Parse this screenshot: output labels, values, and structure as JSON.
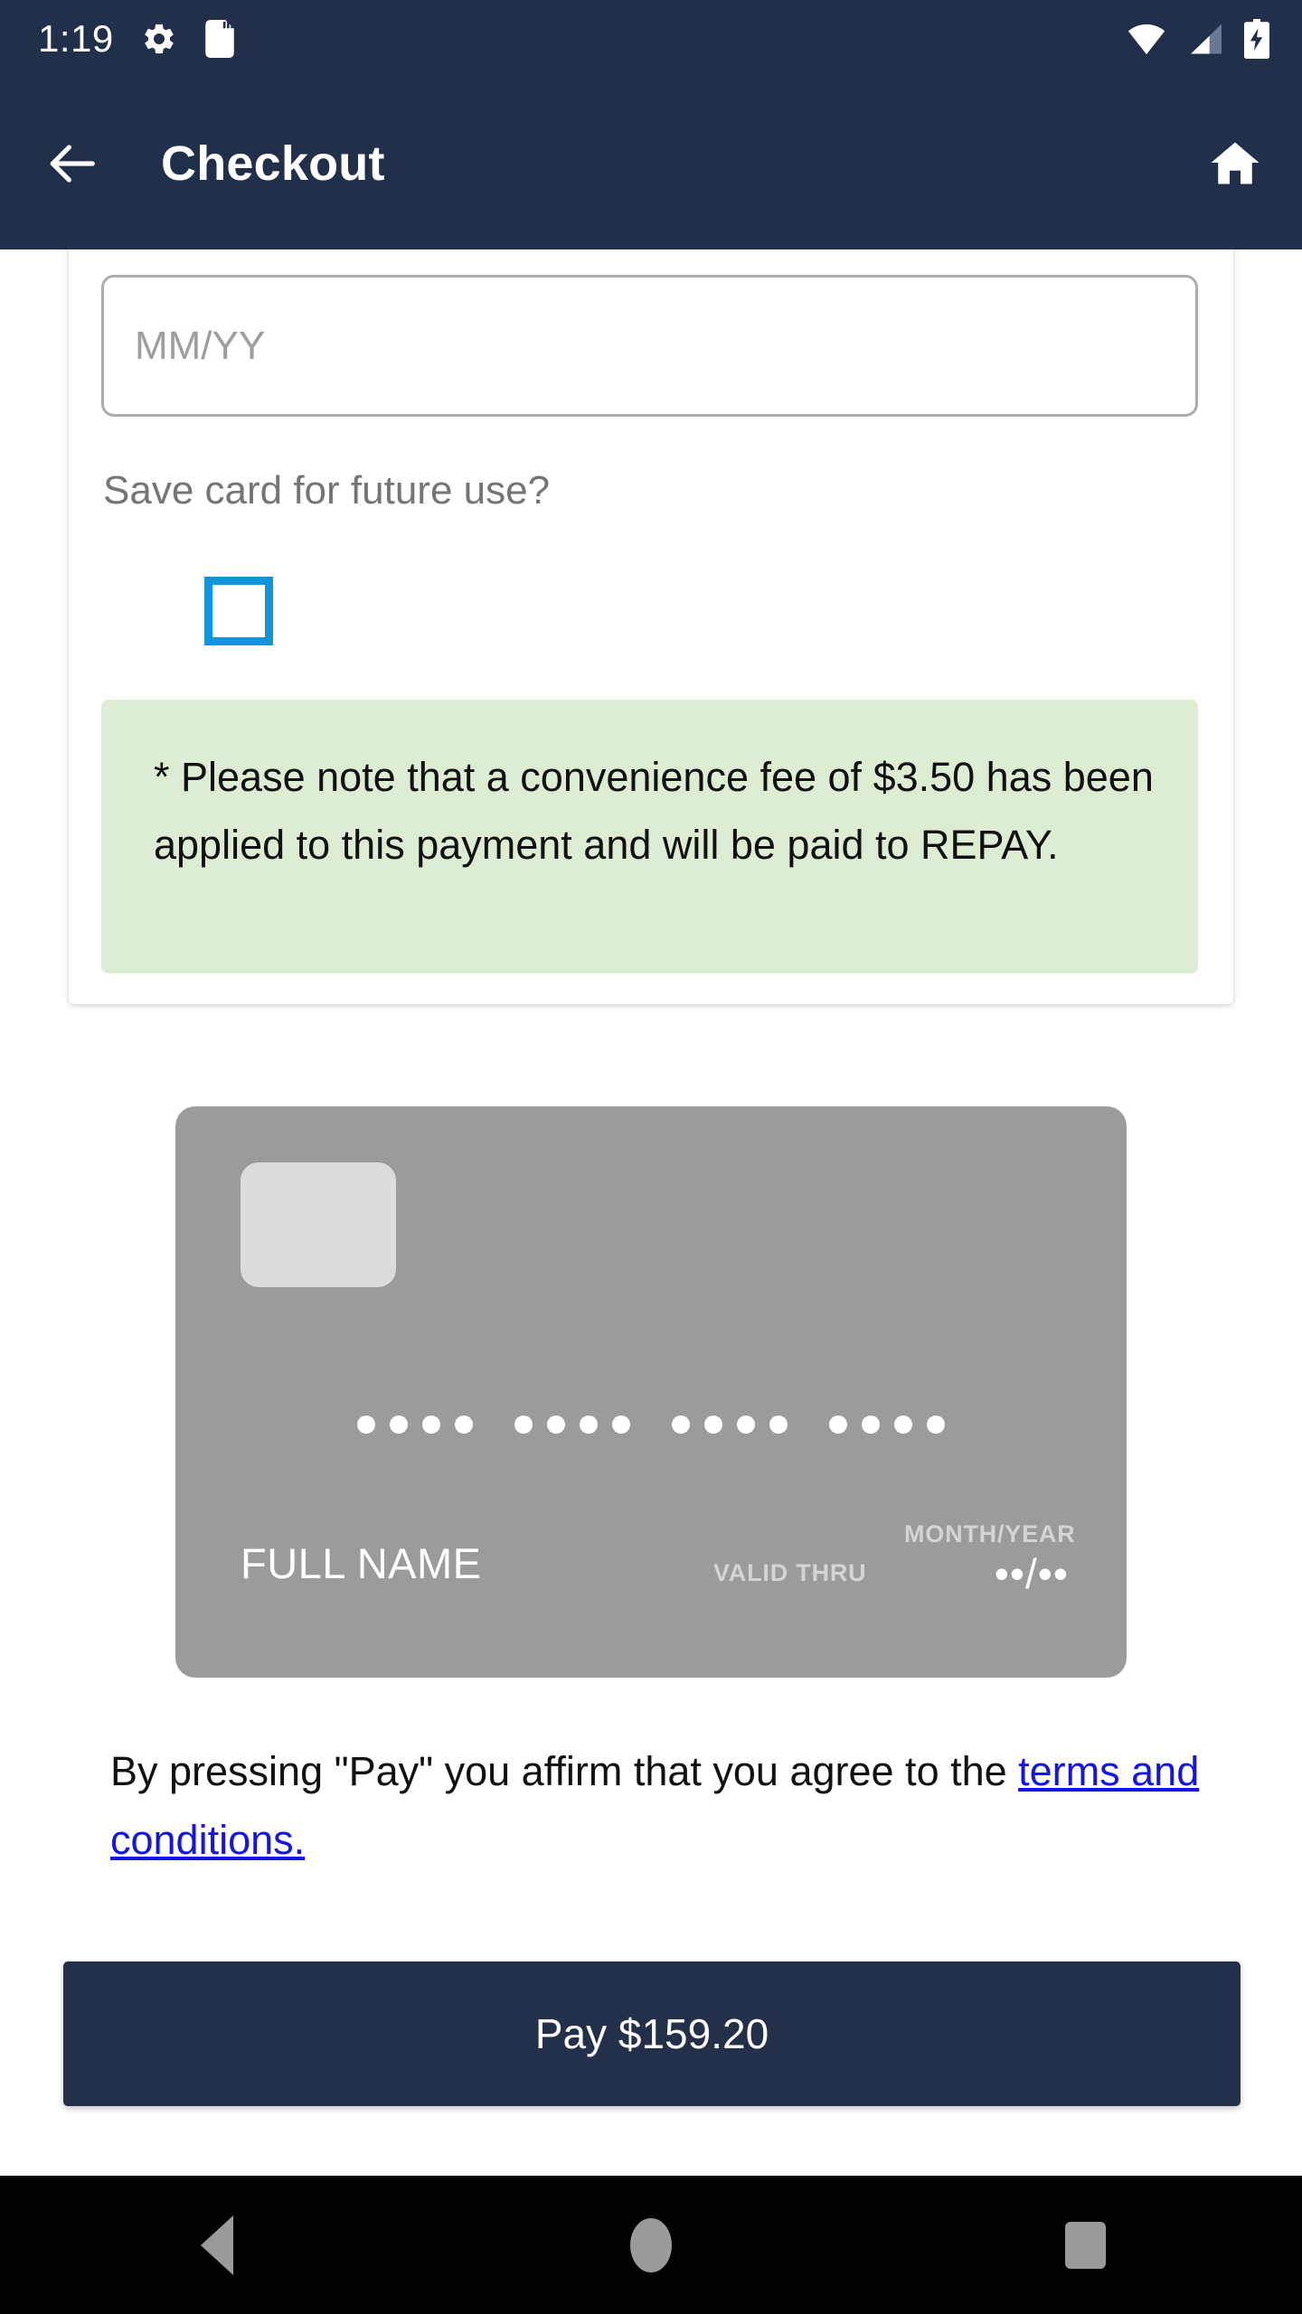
{
  "status_bar": {
    "time": "1:19",
    "left_icons": [
      "settings-gear-icon",
      "sd-card-icon"
    ],
    "right_icons": [
      "wifi-icon",
      "cellular-signal-icon",
      "battery-charging-icon"
    ],
    "background_color": "#222F4B"
  },
  "app_bar": {
    "back_icon": "back-arrow-icon",
    "title": "Checkout",
    "home_icon": "home-icon",
    "background_color": "#222F4B"
  },
  "form": {
    "clipped_label": "",
    "expiry_placeholder": "MM/YY",
    "expiry_value": "",
    "save_card_label": "Save card for future use?",
    "save_card_checked": false,
    "checkbox_color": "#1094DB",
    "notice": "* Please note that a convenience fee of $3.50 has been applied to this payment and will be paid to REPAY.",
    "notice_background": "#DCEDD3"
  },
  "credit_card": {
    "background_color": "#9B9B9B",
    "chip_color": "#DCDCDC",
    "number_groups": [
      "••••",
      "••••",
      "••••",
      "••••"
    ],
    "name": "FULL NAME",
    "valid_thru_label": "VALID THRU",
    "expiry_label": "MONTH/YEAR",
    "expiry_value": "••/••"
  },
  "footer": {
    "terms_prefix": "By pressing \"Pay\" you affirm that you agree to the ",
    "terms_link": "terms and conditions.",
    "link_color": "#1414E6",
    "pay_button_label": "Pay $159.20",
    "pay_button_color": "#242F49"
  },
  "nav_bar": {
    "back_icon": "nav-back-triangle-icon",
    "home_icon": "nav-home-circle-icon",
    "recents_icon": "nav-recents-square-icon",
    "background_color": "#000000"
  }
}
